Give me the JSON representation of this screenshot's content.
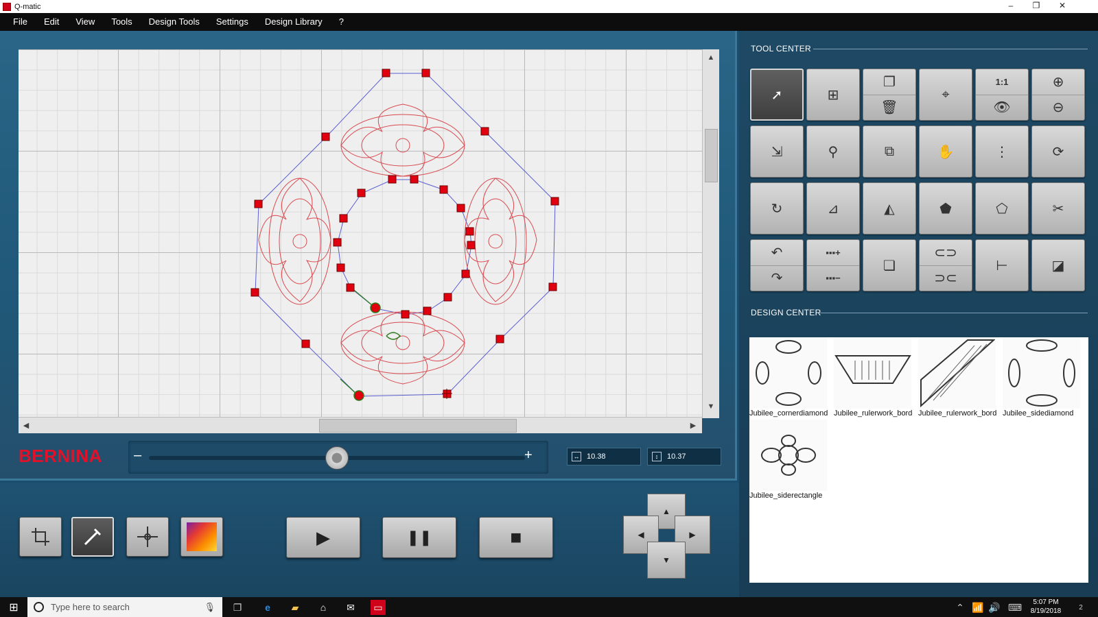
{
  "window": {
    "title": "Q-matic",
    "minimize": "–",
    "maximize": "❐",
    "close": "✕"
  },
  "menu": [
    "File",
    "Edit",
    "View",
    "Tools",
    "Design Tools",
    "Settings",
    "Design Library",
    "?"
  ],
  "logo": "BERNINA",
  "zoom": {
    "minus": "–",
    "plus": "+",
    "level_fraction": 0.5
  },
  "dimensions": {
    "width": "10.38",
    "height": "10.37"
  },
  "tool_center": {
    "title": "TOOL CENTER",
    "tools": [
      {
        "name": "select-tool",
        "icon": "pointer-icon",
        "glyph": "➚",
        "selected": true
      },
      {
        "name": "add-design-tool",
        "icon": "add-design-icon",
        "glyph": "⊞"
      },
      {
        "name": "duplicate-delete-tool",
        "icon": "duplicate-icon",
        "glyph": "❐",
        "glyph2": "🗑"
      },
      {
        "name": "locate-tool",
        "icon": "crosshair-icon",
        "glyph": "⌖"
      },
      {
        "name": "actual-size-preview-tool",
        "icon": "actual-size-icon",
        "glyph": "1:1",
        "glyph2": "👁"
      },
      {
        "name": "zoom-tool",
        "icon": "zoom-in-icon",
        "glyph": "⊕",
        "glyph2": "⊖"
      },
      {
        "name": "resize-tool",
        "icon": "resize-icon",
        "glyph": "⇲"
      },
      {
        "name": "pin-tool",
        "icon": "pin-icon",
        "glyph": "⚲"
      },
      {
        "name": "crop-tool",
        "icon": "crop-icon",
        "glyph": "⧉"
      },
      {
        "name": "pan-tool",
        "icon": "hand-icon",
        "glyph": "✋"
      },
      {
        "name": "sequence-tool",
        "icon": "sequence-icon",
        "glyph": "⋮"
      },
      {
        "name": "rotate-copy-tool",
        "icon": "rotate-copy-icon",
        "glyph": "⟳"
      },
      {
        "name": "rotate-tool",
        "icon": "rotate-icon",
        "glyph": "↻"
      },
      {
        "name": "skew-tool",
        "icon": "skew-icon",
        "glyph": "⊿"
      },
      {
        "name": "mirror-tool",
        "icon": "mirror-icon",
        "glyph": "◭"
      },
      {
        "name": "shape-tool",
        "icon": "pentagon-icon",
        "glyph": "⬟"
      },
      {
        "name": "distort-tool",
        "icon": "distort-icon",
        "glyph": "⬠"
      },
      {
        "name": "cut-tool",
        "icon": "scissors-icon",
        "glyph": "✂"
      },
      {
        "name": "undo-redo-tool",
        "icon": "undo-icon",
        "glyph": "↶",
        "glyph2": "↷"
      },
      {
        "name": "node-add-remove-tool",
        "icon": "node-add-icon",
        "glyph": "▪▪▪+",
        "glyph2": "▪▪▪−"
      },
      {
        "name": "layer-tool",
        "icon": "layer-icon",
        "glyph": "❏"
      },
      {
        "name": "link-tool",
        "icon": "link-icon",
        "glyph": "⊂⊃",
        "glyph2": "⊃⊂"
      },
      {
        "name": "align-tool",
        "icon": "align-icon",
        "glyph": "⊢"
      },
      {
        "name": "fit-tool",
        "icon": "fit-icon",
        "glyph": "◪"
      }
    ]
  },
  "design_center": {
    "title": "DESIGN CENTER",
    "designs": [
      {
        "label": "Jubilee_cornerdiamond"
      },
      {
        "label": "Jubilee_rulerwork_borde"
      },
      {
        "label": "Jubilee_rulerwork_borde"
      },
      {
        "label": "Jubilee_sidediamond"
      },
      {
        "label": "Jubilee_siderectangle"
      }
    ]
  },
  "mode_buttons": [
    {
      "name": "crop-mode-button",
      "icon": "crop-icon",
      "selected": false
    },
    {
      "name": "edit-path-button",
      "icon": "pen-icon",
      "selected": true
    },
    {
      "name": "move-button",
      "icon": "move-icon",
      "selected": false
    },
    {
      "name": "color-button",
      "icon": "color-icon",
      "selected": false
    }
  ],
  "playback": {
    "play": "▶",
    "pause": "❚❚",
    "stop": "■"
  },
  "dpad": {
    "up": "▲",
    "left": "◀",
    "right": "▶",
    "down": "▼"
  },
  "taskbar": {
    "search_placeholder": "Type here to search",
    "time": "5:07 PM",
    "date": "8/19/2018",
    "notifications": "2"
  },
  "colors": {
    "accent": "#e2112a",
    "panel": "#1e4964",
    "node": "#e00010"
  }
}
